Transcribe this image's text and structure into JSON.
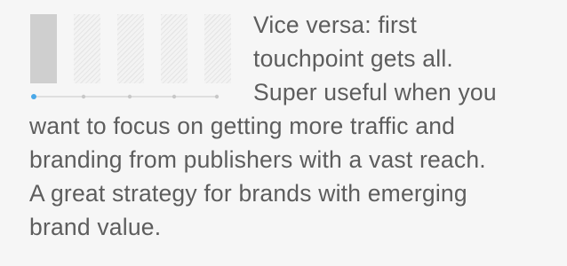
{
  "description": {
    "lines": [
      "Vice versa: first",
      "touchpoint gets all.",
      "Super useful when you",
      "want to focus on getting more traffic and",
      "branding from publishers with a vast reach.",
      "A great strategy for brands with emerging",
      "brand value."
    ]
  },
  "graphic": {
    "bars": [
      {
        "kind": "solid"
      },
      {
        "kind": "hatched"
      },
      {
        "kind": "hatched"
      },
      {
        "kind": "hatched"
      },
      {
        "kind": "hatched"
      }
    ],
    "timeline_points": 5,
    "active_point": 1,
    "accent_color": "#4aa8e8",
    "muted_color": "#c8c8c8"
  }
}
